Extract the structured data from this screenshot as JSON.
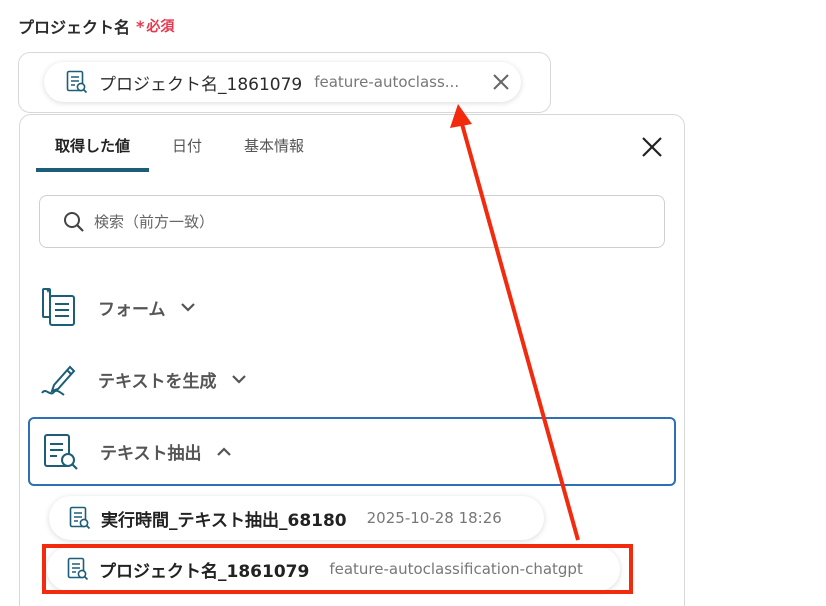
{
  "field": {
    "label": "プロジェクト名",
    "required_star": "*",
    "required_text": "必須",
    "chip_name": "プロジェクト名_1861079",
    "chip_value": "feature-autoclass..."
  },
  "panel": {
    "tabs": [
      {
        "label": "取得した値",
        "active": true
      },
      {
        "label": "日付",
        "active": false
      },
      {
        "label": "基本情報",
        "active": false
      }
    ],
    "search_placeholder": "検索（前方一致）",
    "groups": [
      {
        "label": "フォーム",
        "icon": "form-icon",
        "expanded": false
      },
      {
        "label": "テキストを生成",
        "icon": "pen-icon",
        "expanded": false
      },
      {
        "label": "テキスト抽出",
        "icon": "document-search-icon",
        "expanded": true
      }
    ],
    "items": [
      {
        "name": "実行時間_テキスト抽出_68180",
        "meta": "2025-10-28 18:26"
      },
      {
        "name": "プロジェクト名_1861079",
        "meta": "feature-autoclassification-chatgpt"
      }
    ]
  },
  "colors": {
    "accent": "#1c5e78",
    "required": "#e8384f",
    "annotation": "#f22a0e",
    "selected_border": "#2e6fb5"
  }
}
